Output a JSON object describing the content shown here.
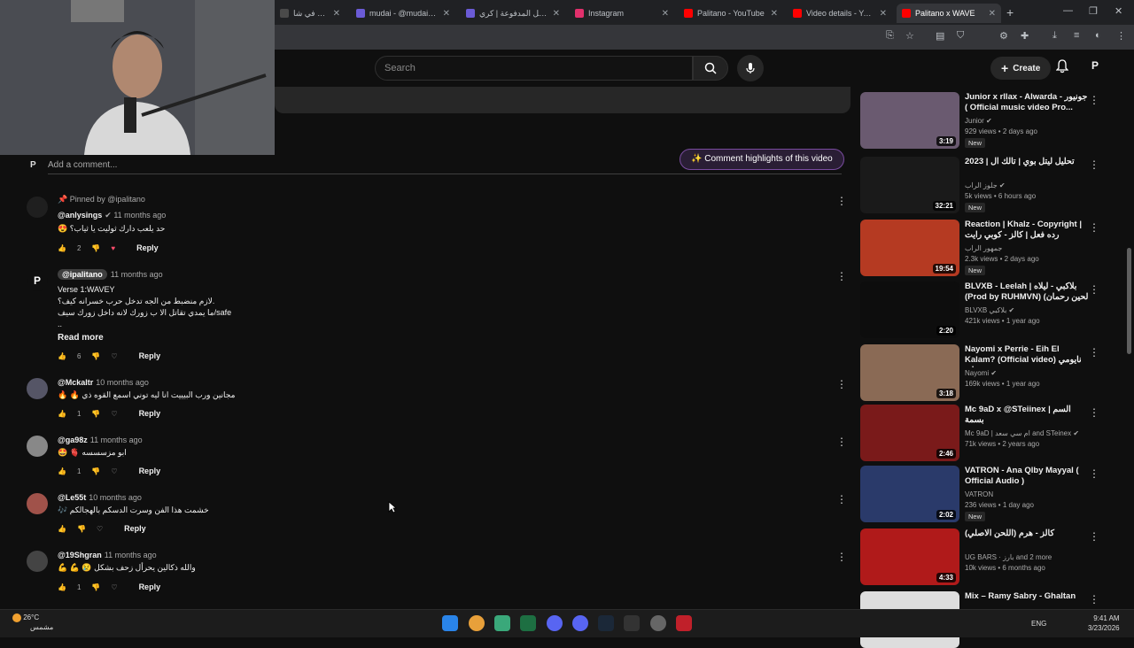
{
  "browser": {
    "tabs": [
      {
        "label": "انضم للعمل في شا",
        "favicon_color": "#4a4a4a",
        "active": false
      },
      {
        "label": "mudai - @mudai | Cr",
        "favicon_color": "#6b5bd6",
        "active": false
      },
      {
        "label": "الرسائل المدفوعة | كري",
        "favicon_color": "#6b5bd6",
        "active": false
      },
      {
        "label": "Instagram",
        "favicon_color": "#e1306c",
        "active": false
      },
      {
        "label": "Palitano - YouTube",
        "favicon_color": "#ff0000",
        "active": false
      },
      {
        "label": "Video details - YouTu",
        "favicon_color": "#ff0000",
        "active": false
      },
      {
        "label": "Palitano x WAVE",
        "favicon_color": "#ff0000",
        "active": true
      }
    ],
    "new_tab_icon": "+",
    "window_controls": [
      "—",
      "❐",
      "✕"
    ]
  },
  "header": {
    "search_placeholder": "Search",
    "create_label": "Create",
    "avatar_letter": "P"
  },
  "comments_section": {
    "add_comment_placeholder": "Add a comment...",
    "avatar_letter": "P",
    "highlights_label": "✨ Comment highlights of this video",
    "comments": [
      {
        "pinned_label": "Pinned by @ipalitano",
        "author": "@anlysings",
        "verified": true,
        "time": "11 months ago",
        "text": "😍 حد يلعب دارك ثوليت يا ثياب؟",
        "likes": "2",
        "reply": "Reply"
      },
      {
        "author": "@ipalitano",
        "time": "11 months ago",
        "is_creator": true,
        "text": "Verse 1:WAVEY\nلازم منضبط من الجه تدخل حرب خسرانه كيف؟.\nما يمدي تقاتل الا ب زورك لانه داخل زورك سيف/safe\n..",
        "read_more": "Read more",
        "likes": "6",
        "reply": "Reply"
      },
      {
        "author": "@Mckaltr",
        "time": "10 months ago",
        "text": "🔥 🔥 مجانين ورب البيييت انا ليه توني اسمع القوه ذي",
        "likes": "1",
        "reply": "Reply"
      },
      {
        "author": "@ga98z",
        "time": "11 months ago",
        "text": "🤩 🫀 ابو مزسسسه",
        "likes": "1",
        "reply": "Reply"
      },
      {
        "author": "@Le55t",
        "time": "10 months ago",
        "text": "🎶 خشمت هذا الفن وسرت الدسكم بالهجالكم",
        "likes": "",
        "reply": "Reply"
      },
      {
        "author": "@19Shgran",
        "time": "11 months ago",
        "text": "💪 💪 😢 والله ذكالين يحرأل زحف بشكل",
        "likes": "1",
        "reply": "Reply"
      }
    ]
  },
  "sidebar": {
    "videos": [
      {
        "title": "Junior x rllax - Alwarda - جونيور ( Official music video Pro...",
        "channel": "Junior",
        "verified": true,
        "stats": "929 views • 2 days ago",
        "new": "New",
        "duration": "3:19",
        "thumb_color": "#6a5a70"
      },
      {
        "title": "تحليل ليتل بوي | تالك ال | 2023",
        "channel": "جلوز الراب",
        "verified": true,
        "stats": "5k views • 6 hours ago",
        "new": "New",
        "duration": "32:21",
        "thumb_color": "#1a1a1a"
      },
      {
        "title": "Reaction | Khalz - Copyright | رده فعل | كالز - كوبي رايت",
        "channel": "جمهور الراب",
        "verified": false,
        "stats": "2.3k views • 2 days ago",
        "new": "New",
        "duration": "19:54",
        "thumb_color": "#b53a22"
      },
      {
        "title": "BLVXB - Leelah | بلاكبي - ليلاه (Prod by RUHMVN) (لحين رحمان",
        "channel": "BLVXB بلاكبي",
        "verified": true,
        "stats": "421k views • 1 year ago",
        "new": "",
        "duration": "2:20",
        "thumb_color": "#0d0d0d"
      },
      {
        "title": "Nayomi x Perrie - Eih El Kalam? (Official video) نايومي بيري - ايه ...",
        "channel": "Nayomi",
        "verified": true,
        "stats": "169k views • 1 year ago",
        "new": "",
        "duration": "3:18",
        "thumb_color": "#8a6a55"
      },
      {
        "title": "Mc 9aD x @STeiinex | السم بسمة",
        "channel": "Mc 9aD | ام سي سعد and STeinex",
        "verified": true,
        "stats": "71k views • 2 years ago",
        "new": "",
        "duration": "2:46",
        "thumb_color": "#7a1a1a"
      },
      {
        "title": "VATRON - Ana Qlby Mayyal ( Official Audio )",
        "channel": "VATRON",
        "verified": false,
        "stats": "236 views • 1 day ago",
        "new": "New",
        "duration": "2:02",
        "thumb_color": "#2a3a6a"
      },
      {
        "title": "كالز - هرم (اللحن الاصلي)",
        "channel": "UG BARS · بارز and 2 more",
        "verified": false,
        "stats": "10k views • 6 months ago",
        "new": "",
        "duration": "4:33",
        "thumb_color": "#b01a1a"
      },
      {
        "title": "Mix – Ramy Sabry - Ghaltan",
        "channel": "",
        "verified": false,
        "stats": "",
        "new": "",
        "duration": "",
        "thumb_color": "#dddddd"
      }
    ]
  },
  "taskbar": {
    "weather_temp": "26°C",
    "weather_desc": "مشمس",
    "lang": "ENG",
    "time": "9:41 AM",
    "date": "3/23/2026"
  },
  "colors": {
    "bg": "#0f0f0f",
    "accent_red": "#ff0000",
    "highlight_border": "#7a4ca0"
  }
}
